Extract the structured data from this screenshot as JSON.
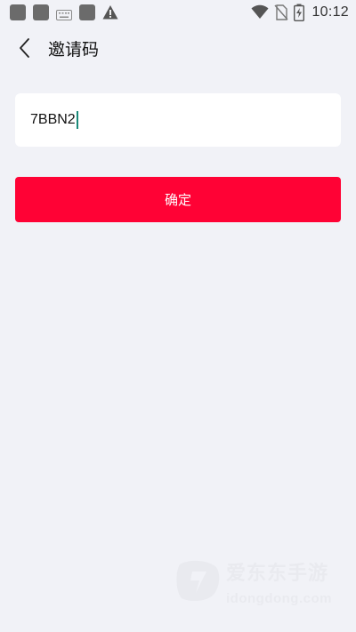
{
  "status_bar": {
    "time": "10:12",
    "left_icons": [
      "app-icon",
      "app-icon",
      "keyboard-icon",
      "app-icon",
      "warning-icon"
    ],
    "right_icons": [
      "wifi-icon",
      "no-sim-icon",
      "battery-charging-icon"
    ]
  },
  "header": {
    "title": "邀请码",
    "back_icon": "chevron-left-icon"
  },
  "form": {
    "invite_code_value": "7BBN2"
  },
  "actions": {
    "confirm_label": "确定"
  },
  "watermark": {
    "brand_cn": "爱东东手游",
    "brand_url": "idongdong.com"
  },
  "colors": {
    "background": "#f1f2f7",
    "card": "#ffffff",
    "accent": "#ff0235",
    "caret": "#1a8a7a"
  }
}
